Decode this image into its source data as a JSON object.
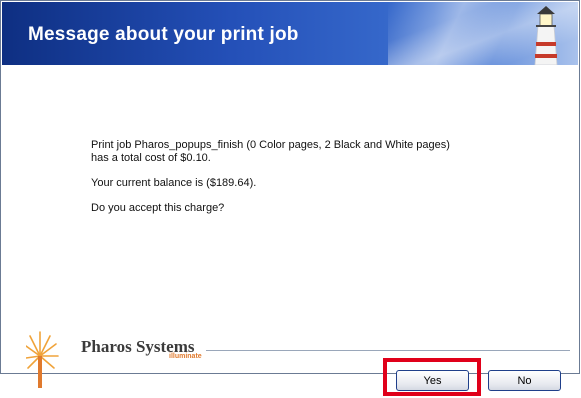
{
  "dialog": {
    "title": "Message about your print job",
    "message_line1": "Print job Pharos_popups_finish (0 Color pages, 2 Black and White pages)",
    "message_line2": "has a total cost of $0.10.",
    "balance": "Your current balance is ($189.64).",
    "question": "Do you accept this charge?"
  },
  "branding": {
    "company": "Pharos Systems",
    "tagline": "illuminate"
  },
  "buttons": {
    "yes": "Yes",
    "no": "No"
  },
  "colors": {
    "banner_dark": "#0e2f82",
    "banner_light": "#a9c2ec",
    "highlight": "#e0001a",
    "tagline": "#e07a2e"
  }
}
